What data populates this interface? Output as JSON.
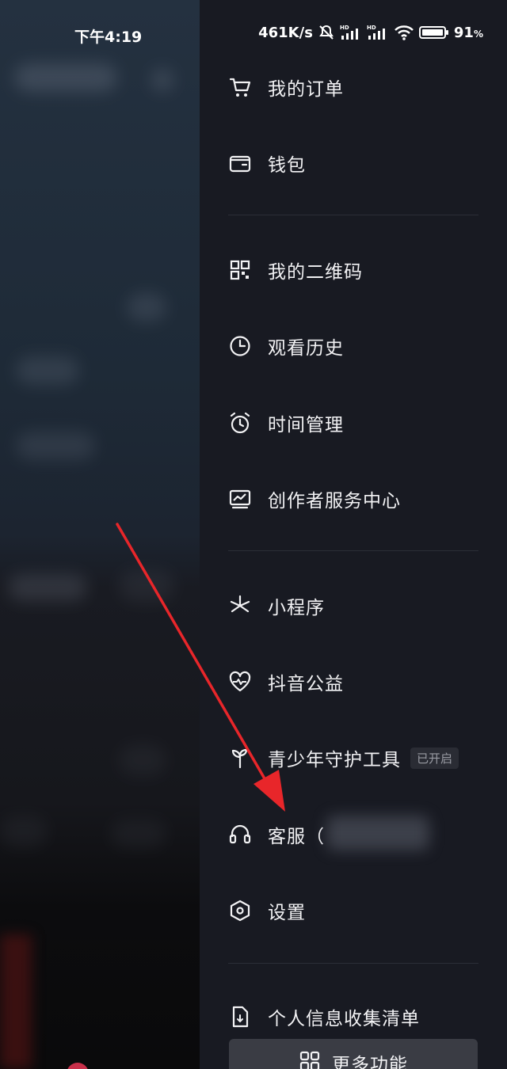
{
  "status_bar": {
    "time": "下午4:19",
    "network_speed": "461K/s",
    "battery": "91",
    "battery_unit": "%"
  },
  "drawer": {
    "items": [
      {
        "label": "我的订单",
        "icon": "cart-icon"
      },
      {
        "label": "钱包",
        "icon": "wallet-icon"
      },
      {
        "label": "我的二维码",
        "icon": "qr-code-icon"
      },
      {
        "label": "观看历史",
        "icon": "clock-icon"
      },
      {
        "label": "时间管理",
        "icon": "alarm-clock-icon"
      },
      {
        "label": "创作者服务中心",
        "icon": "creator-chart-icon"
      },
      {
        "label": "小程序",
        "icon": "mini-program-icon"
      },
      {
        "label": "抖音公益",
        "icon": "charity-heart-icon"
      },
      {
        "label": "青少年守护工具",
        "icon": "sprout-icon",
        "badge": "已开启"
      },
      {
        "label": "客服（",
        "icon": "headset-icon"
      },
      {
        "label": "设置",
        "icon": "settings-hexagon-icon"
      },
      {
        "label": "个人信息收集清单",
        "icon": "document-icon"
      }
    ],
    "more_button": {
      "label": "更多功能",
      "icon": "grid-icon"
    }
  },
  "annotation": {
    "color": "#e8262a"
  }
}
